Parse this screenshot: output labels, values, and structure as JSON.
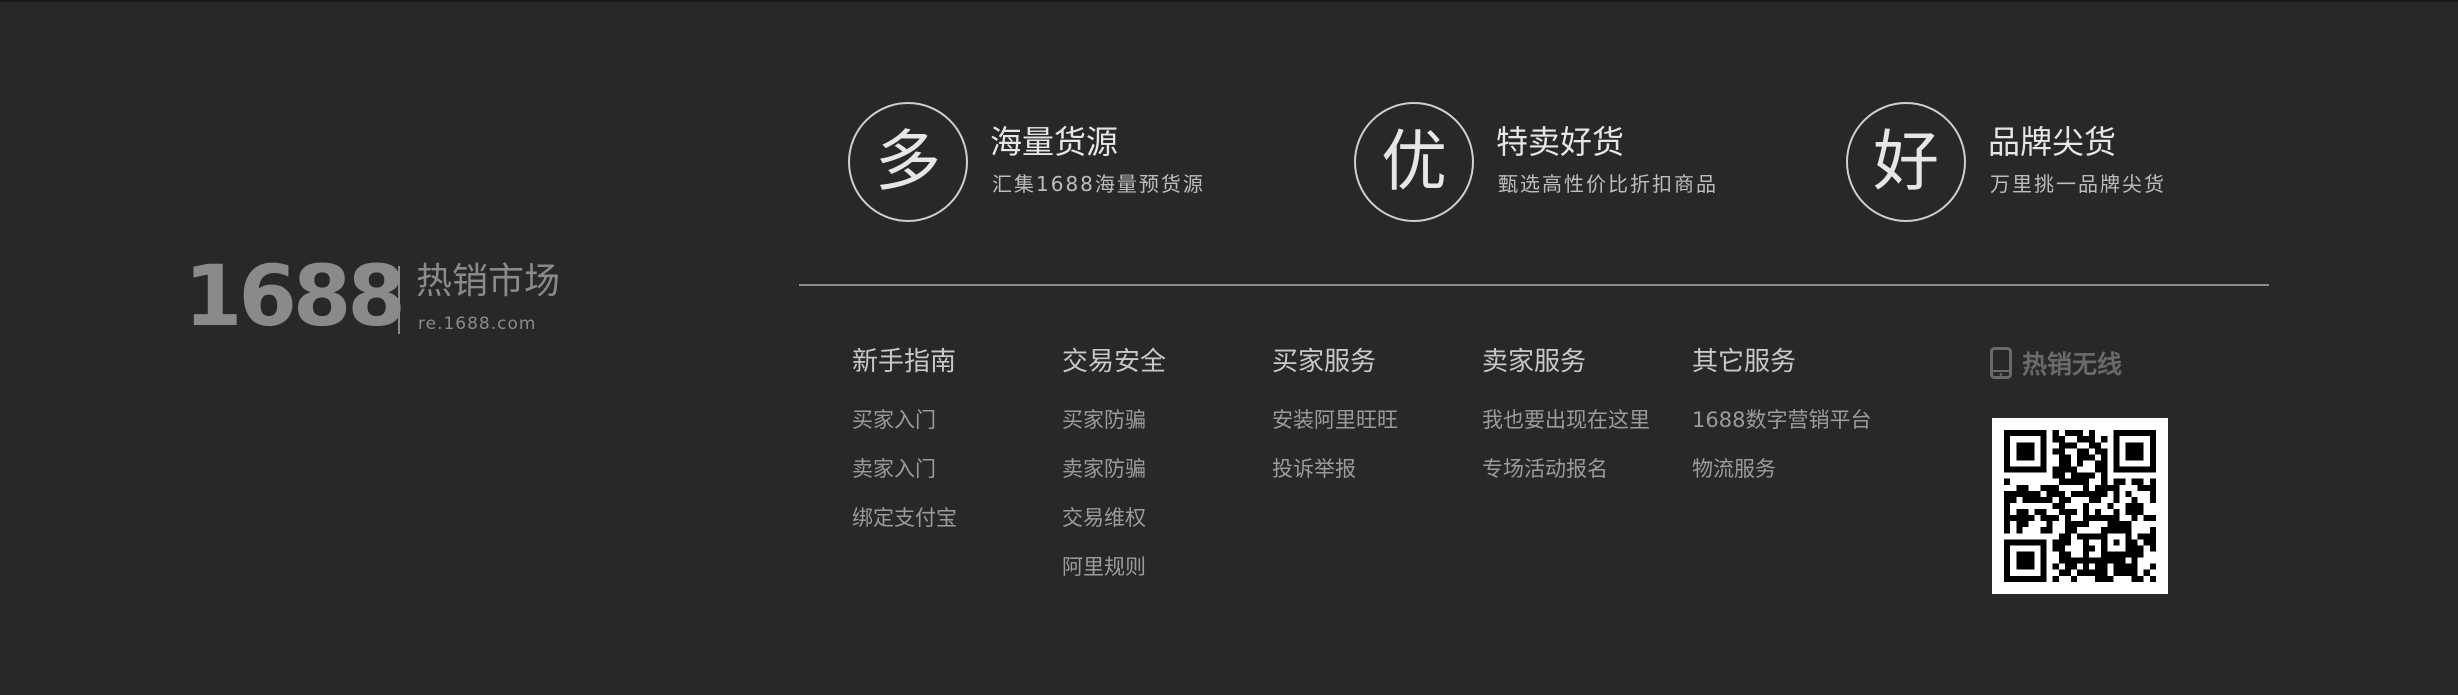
{
  "brand": {
    "number": "1688",
    "name_cn": "热销市场",
    "url": "re.1688.com"
  },
  "features": [
    {
      "glyph": "多",
      "title": "海量货源",
      "subtitle": "汇集1688海量预货源"
    },
    {
      "glyph": "优",
      "title": "特卖好货",
      "subtitle": "甄选高性价比折扣商品"
    },
    {
      "glyph": "好",
      "title": "品牌尖货",
      "subtitle": "万里挑一品牌尖货"
    }
  ],
  "columns": [
    {
      "title": "新手指南",
      "items": [
        "买家入门",
        "卖家入门",
        "绑定支付宝"
      ]
    },
    {
      "title": "交易安全",
      "items": [
        "买家防骗",
        "卖家防骗",
        "交易维权",
        "阿里规则"
      ]
    },
    {
      "title": "买家服务",
      "items": [
        "安装阿里旺旺",
        "投诉举报"
      ]
    },
    {
      "title": "卖家服务",
      "items": [
        "我也要出现在这里",
        "专场活动报名"
      ]
    },
    {
      "title": "其它服务",
      "items": [
        "1688数字营销平台",
        "物流服务"
      ]
    }
  ],
  "mobile": {
    "title": "热销无线",
    "icon": "phone-icon"
  },
  "colors": {
    "background": "#282828",
    "text_light": "#e6e6e6",
    "text_muted": "#9b9b9b"
  }
}
